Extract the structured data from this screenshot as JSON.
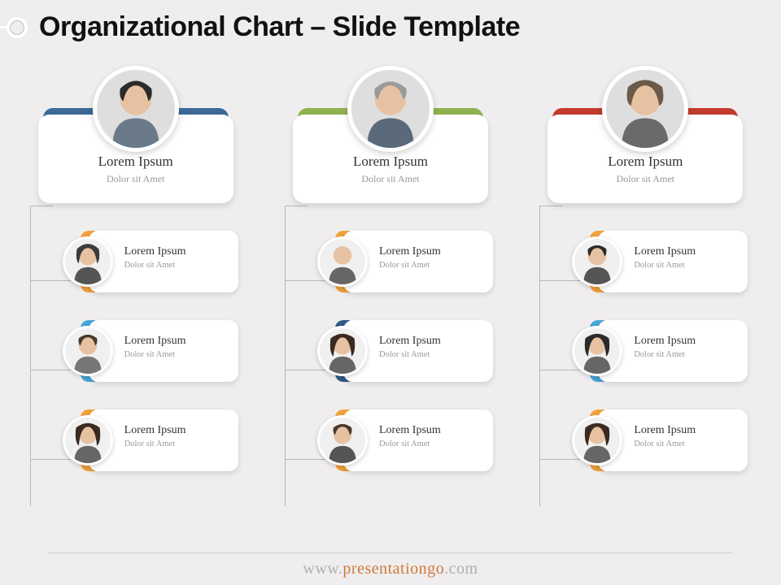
{
  "title": "Organizational Chart – Slide Template",
  "footer": {
    "prefix": "www.",
    "mid": "presentationgo",
    "suffix": ".com"
  },
  "columns": [
    {
      "head": {
        "name": "Lorem Ipsum",
        "role": "Dolor sit Amet",
        "accent": "#3d6a97",
        "avatar": {
          "hair": "#2b2b2b",
          "skin": "#e7c2a2",
          "bg": "#dedede"
        }
      },
      "children": [
        {
          "name": "Lorem Ipsum",
          "role": "Dolor sit Amet",
          "accent": "#f2a23a",
          "avatar": {
            "hair": "#3b3b3b",
            "skin": "#e7c2a2",
            "bg": "#f0f0f0"
          }
        },
        {
          "name": "Lorem Ipsum",
          "role": "Dolor sit Amet",
          "accent": "#4aa6d9",
          "avatar": {
            "hair": "#4a3a2a",
            "skin": "#e7c2a2",
            "bg": "#f0f0f0"
          }
        },
        {
          "name": "Lorem Ipsum",
          "role": "Dolor sit Amet",
          "accent": "#f2a23a",
          "avatar": {
            "hair": "#3a2a20",
            "skin": "#e7c2a2",
            "bg": "#f0f0f0"
          }
        }
      ]
    },
    {
      "head": {
        "name": "Lorem Ipsum",
        "role": "Dolor sit Amet",
        "accent": "#8fb24f",
        "avatar": {
          "hair": "#9a9a9a",
          "skin": "#e7c2a2",
          "bg": "#dedede"
        }
      },
      "children": [
        {
          "name": "Lorem Ipsum",
          "role": "Dolor sit Amet",
          "accent": "#f2a23a",
          "avatar": {
            "hair": "#e7c2a2",
            "skin": "#e7c2a2",
            "bg": "#f0f0f0"
          }
        },
        {
          "name": "Lorem Ipsum",
          "role": "Dolor sit Amet",
          "accent": "#2f5a87",
          "avatar": {
            "hair": "#3a2a20",
            "skin": "#e7c2a2",
            "bg": "#f0f0f0"
          }
        },
        {
          "name": "Lorem Ipsum",
          "role": "Dolor sit Amet",
          "accent": "#f2a23a",
          "avatar": {
            "hair": "#4a3a2a",
            "skin": "#e7c2a2",
            "bg": "#f0f0f0"
          }
        }
      ]
    },
    {
      "head": {
        "name": "Lorem Ipsum",
        "role": "Dolor sit Amet",
        "accent": "#c23b2e",
        "avatar": {
          "hair": "#6b5a4a",
          "skin": "#e7c2a2",
          "bg": "#dedede"
        }
      },
      "children": [
        {
          "name": "Lorem Ipsum",
          "role": "Dolor sit Amet",
          "accent": "#f2a23a",
          "avatar": {
            "hair": "#2b2b2b",
            "skin": "#e7c2a2",
            "bg": "#f0f0f0"
          }
        },
        {
          "name": "Lorem Ipsum",
          "role": "Dolor sit Amet",
          "accent": "#4aa6d9",
          "avatar": {
            "hair": "#2b2b2b",
            "skin": "#e7c2a2",
            "bg": "#f0f0f0"
          }
        },
        {
          "name": "Lorem Ipsum",
          "role": "Dolor sit Amet",
          "accent": "#f2a23a",
          "avatar": {
            "hair": "#3a2a20",
            "skin": "#e7c2a2",
            "bg": "#f0f0f0"
          }
        }
      ]
    }
  ]
}
